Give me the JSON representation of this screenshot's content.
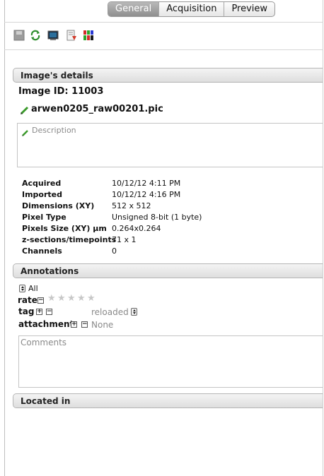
{
  "tabs": [
    {
      "label": "General",
      "active": true
    },
    {
      "label": "Acquisition",
      "active": false
    },
    {
      "label": "Preview",
      "active": false
    }
  ],
  "toolbar": {
    "icons": [
      "save-icon",
      "refresh-icon",
      "viewer-icon",
      "download-icon",
      "channels-icon"
    ]
  },
  "image_details": {
    "header": "Image's details",
    "image_id_label": "Image ID: 11003",
    "filename": "arwen0205_raw00201.pic",
    "description_placeholder": "Description",
    "rows": [
      {
        "label": "Acquired",
        "value": "10/12/12 4:11 PM"
      },
      {
        "label": "Imported",
        "value": "10/12/12 4:16 PM"
      },
      {
        "label": "Dimensions (XY)",
        "value": "512 x 512"
      },
      {
        "label": "Pixel Type",
        "value": "Unsigned 8-bit (1 byte)"
      },
      {
        "label": "Pixels Size (XY) µm",
        "value": "0.264x0.264"
      },
      {
        "label": "z-sections/timepoints",
        "value": "71 x 1"
      },
      {
        "label": "Channels",
        "value": "0"
      }
    ]
  },
  "annotations": {
    "header": "Annotations",
    "filter_label": "All",
    "rate_label": "rate",
    "rating": 0,
    "rating_max": 5,
    "tag_label": "tag",
    "tag_value": "reloaded",
    "attachment_label": "attachment",
    "attachment_value": "None",
    "comments_placeholder": "Comments"
  },
  "located_in": {
    "header": "Located in"
  },
  "colors": {
    "edit_pencil": "#3a9a2a",
    "tab_active": "#8f8f8f",
    "star_empty": "#c8c8c8"
  }
}
